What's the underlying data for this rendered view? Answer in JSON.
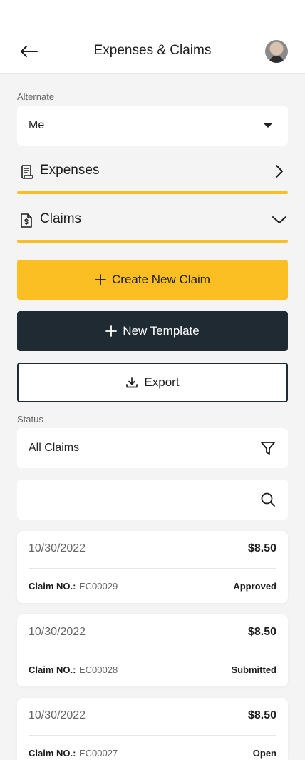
{
  "header": {
    "title": "Expenses & Claims",
    "back_icon": "arrow-left-icon",
    "avatar_icon": "user-avatar"
  },
  "alternate": {
    "label": "Alternate",
    "value": "Me"
  },
  "sections": {
    "expenses": {
      "label": "Expenses",
      "icon": "receipt-icon",
      "state": "collapsed"
    },
    "claims": {
      "label": "Claims",
      "icon": "dollar-document-icon",
      "state": "expanded"
    }
  },
  "actions": {
    "create_claim": "Create New Claim",
    "new_template": "New Template",
    "export": "Export"
  },
  "status": {
    "label": "Status",
    "value": "All Claims"
  },
  "search": {
    "placeholder": ""
  },
  "claims": [
    {
      "date": "10/30/2022",
      "amount": "$8.50",
      "claim_no_label": "Claim NO.:",
      "claim_no": "EC00029",
      "status": "Approved"
    },
    {
      "date": "10/30/2022",
      "amount": "$8.50",
      "claim_no_label": "Claim NO.:",
      "claim_no": "EC00028",
      "status": "Submitted"
    },
    {
      "date": "10/30/2022",
      "amount": "$8.50",
      "claim_no_label": "Claim NO.:",
      "claim_no": "EC00027",
      "status": "Open"
    }
  ],
  "colors": {
    "accent": "#fbbf24",
    "dark": "#1f2a33",
    "background": "#f4f4f4"
  }
}
